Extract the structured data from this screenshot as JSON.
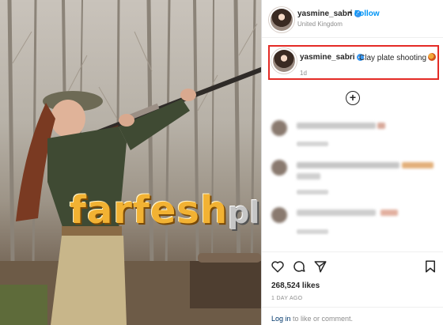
{
  "post": {
    "username": "yasmine_sabri",
    "follow_label": "Follow",
    "separator": "•",
    "location": "United Kingdom"
  },
  "caption": {
    "username": "yasmine_sabri",
    "text": "Clay plate shooting",
    "time": "1d"
  },
  "load_more_label": "+",
  "engagement": {
    "likes": "268,524 likes",
    "date": "1 DAY AGO"
  },
  "login": {
    "link_label": "Log in",
    "rest_text": " to like or comment."
  },
  "watermark": {
    "brand": "farfesh",
    "suffix": "plus.com"
  },
  "colors": {
    "accent_blue": "#0095f6",
    "highlight_border": "#e42b26",
    "verified_badge": "#3897f0"
  },
  "icons": [
    "verified-badge-icon",
    "plus-circle-icon",
    "heart-icon",
    "comment-icon",
    "share-icon",
    "bookmark-icon"
  ]
}
